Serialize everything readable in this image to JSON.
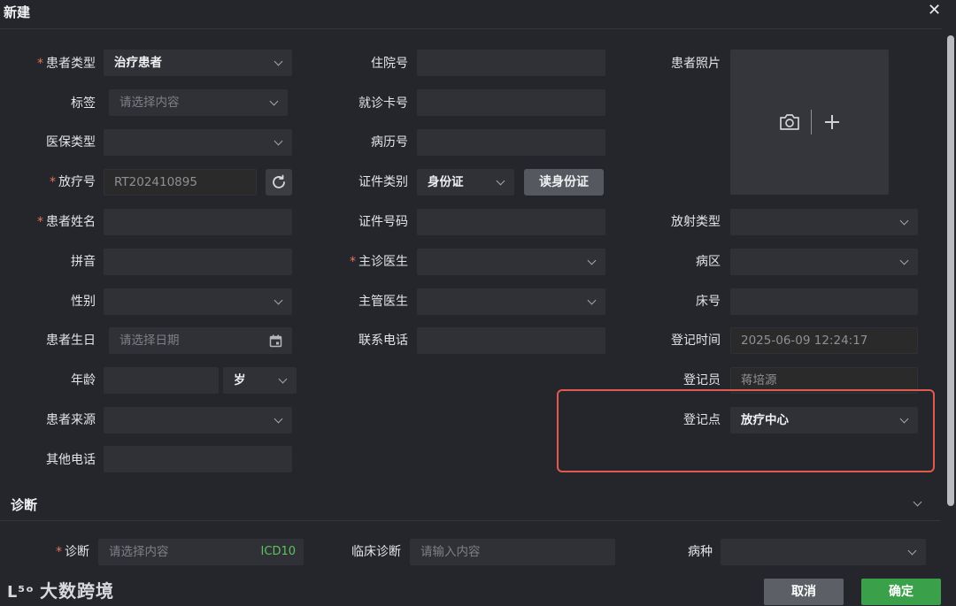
{
  "dialog": {
    "title": "新建",
    "close_glyph": "✕"
  },
  "col1": {
    "patient_type": {
      "label": "患者类型",
      "value": "治疗患者"
    },
    "tag": {
      "label": "标签",
      "placeholder": "请选择内容"
    },
    "insurance_type": {
      "label": "医保类型",
      "value": ""
    },
    "therapy_no": {
      "label": "放疗号",
      "value": "RT202410895"
    },
    "patient_name": {
      "label": "患者姓名",
      "value": ""
    },
    "pinyin": {
      "label": "拼音",
      "value": ""
    },
    "gender": {
      "label": "性别",
      "value": ""
    },
    "birthday": {
      "label": "患者生日",
      "placeholder": "请选择日期"
    },
    "age": {
      "label": "年龄",
      "value": "",
      "unit": "岁"
    },
    "source": {
      "label": "患者来源",
      "value": ""
    },
    "other_phone": {
      "label": "其他电话",
      "value": ""
    }
  },
  "col2": {
    "inpatient_no": {
      "label": "住院号",
      "value": ""
    },
    "visit_card_no": {
      "label": "就诊卡号",
      "value": ""
    },
    "medical_record_no": {
      "label": "病历号",
      "value": ""
    },
    "id_type": {
      "label": "证件类别",
      "value": "身份证",
      "read_button": "读身份证"
    },
    "id_no": {
      "label": "证件号码",
      "value": ""
    },
    "attending_doctor": {
      "label": "主诊医生",
      "value": ""
    },
    "responsible_doctor": {
      "label": "主管医生",
      "value": ""
    },
    "phone": {
      "label": "联系电话",
      "value": ""
    }
  },
  "col3": {
    "photo": {
      "label": "患者照片"
    },
    "radiation_type": {
      "label": "放射类型",
      "value": ""
    },
    "ward": {
      "label": "病区",
      "value": ""
    },
    "bed_no": {
      "label": "床号",
      "value": ""
    },
    "register_time": {
      "label": "登记时间",
      "value": "2025-06-09 12:24:17"
    },
    "registrar": {
      "label": "登记员",
      "value": "蒋培源"
    },
    "register_site": {
      "label": "登记点",
      "value": "放疗中心"
    }
  },
  "diagnosis": {
    "section_title": "诊断",
    "diagnosis": {
      "label": "诊断",
      "placeholder": "请选择内容",
      "code": "ICD10"
    },
    "clinical": {
      "label": "临床诊断",
      "placeholder": "请输入内容"
    },
    "disease": {
      "label": "病种",
      "value": ""
    }
  },
  "footer": {
    "cancel": "取消",
    "confirm": "确定",
    "watermark": "大数跨境",
    "watermark_mark": "ᒪ⁵ᵒ"
  },
  "colors": {
    "accent_green": "#3aa04a",
    "required": "#e8745a",
    "highlight": "#e05a4f",
    "code_green": "#5cc35c"
  },
  "icons": [
    "close-icon",
    "refresh-icon",
    "calendar-icon",
    "camera-icon",
    "plus-icon",
    "chevron-down-icon"
  ]
}
